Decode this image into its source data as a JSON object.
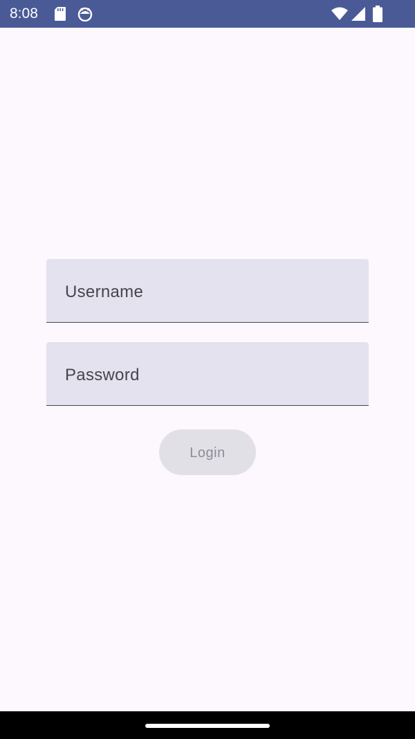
{
  "status_bar": {
    "time": "8:08",
    "icons": [
      "sd-card-icon",
      "android-icon",
      "wifi-icon",
      "signal-icon",
      "battery-icon"
    ]
  },
  "login_form": {
    "username_placeholder": "Username",
    "password_placeholder": "Password",
    "login_label": "Login"
  },
  "colors": {
    "status_bar": "#4a5a96",
    "background": "#fcf8fd",
    "field": "#e3e2ee",
    "button_disabled": "#e1e0e6"
  }
}
